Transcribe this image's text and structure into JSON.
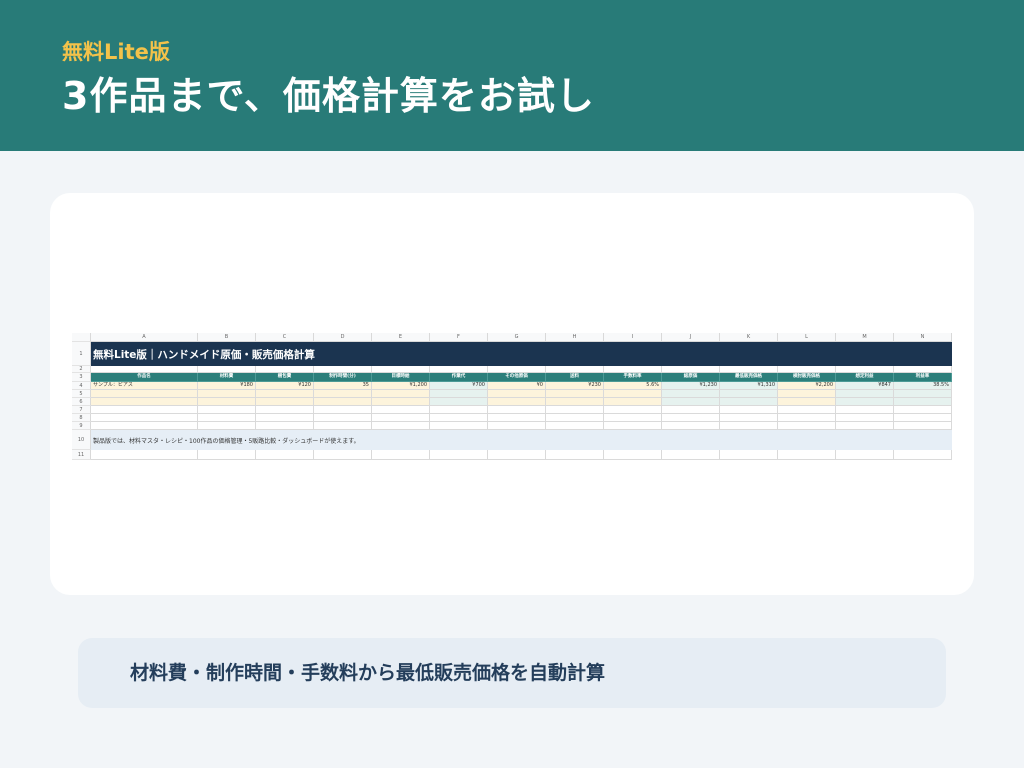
{
  "header": {
    "eyebrow": "無料Lite版",
    "headline": "3作品まで、価格計算をお試し"
  },
  "spreadsheet": {
    "column_letters": [
      "A",
      "B",
      "C",
      "D",
      "E",
      "F",
      "G",
      "H",
      "I",
      "J",
      "K",
      "L",
      "M",
      "N"
    ],
    "row_numbers": [
      "1",
      "2",
      "3",
      "4",
      "5",
      "6",
      "7",
      "8",
      "9",
      "10",
      "11"
    ],
    "title": "無料Lite版｜ハンドメイド原価・販売価格計算",
    "headers": [
      "作品名",
      "材料費",
      "梱包費",
      "制作時間(分)",
      "目標時給",
      "作業代",
      "その他原価",
      "送料",
      "手数料率",
      "総原価",
      "最低販売価格",
      "検討販売価格",
      "想定利益",
      "利益率"
    ],
    "rows": [
      [
        "サンプル：ピアス",
        "¥180",
        "¥120",
        "35",
        "¥1,200",
        "¥700",
        "¥0",
        "¥230",
        "5.6%",
        "¥1,230",
        "¥1,310",
        "¥2,200",
        "¥847",
        "38.5%"
      ],
      [
        "",
        "",
        "",
        "",
        "",
        "",
        "",
        "",
        "",
        "",
        "",
        "",
        "",
        ""
      ],
      [
        "",
        "",
        "",
        "",
        "",
        "",
        "",
        "",
        "",
        "",
        "",
        "",
        "",
        ""
      ],
      [
        "",
        "",
        "",
        "",
        "",
        "",
        "",
        "",
        "",
        "",
        "",
        "",
        "",
        ""
      ]
    ],
    "note": "製品版では、材料マスタ・レシピ・100作品の価格管理・5販路比較・ダッシュボードが使えます。",
    "colors": {
      "title_band": "#1b3450",
      "header_band": "#2c7f7b",
      "input_fill": "#fdf4dc",
      "calc_fill": "#e6f2ef",
      "note_fill": "#e6eef6"
    }
  },
  "caption": {
    "text": "材料費・制作時間・手数料から最低販売価格を自動計算"
  },
  "theme": {
    "banner": "#287b78",
    "eyebrow": "#f3c24a",
    "background": "#f2f5f8"
  }
}
